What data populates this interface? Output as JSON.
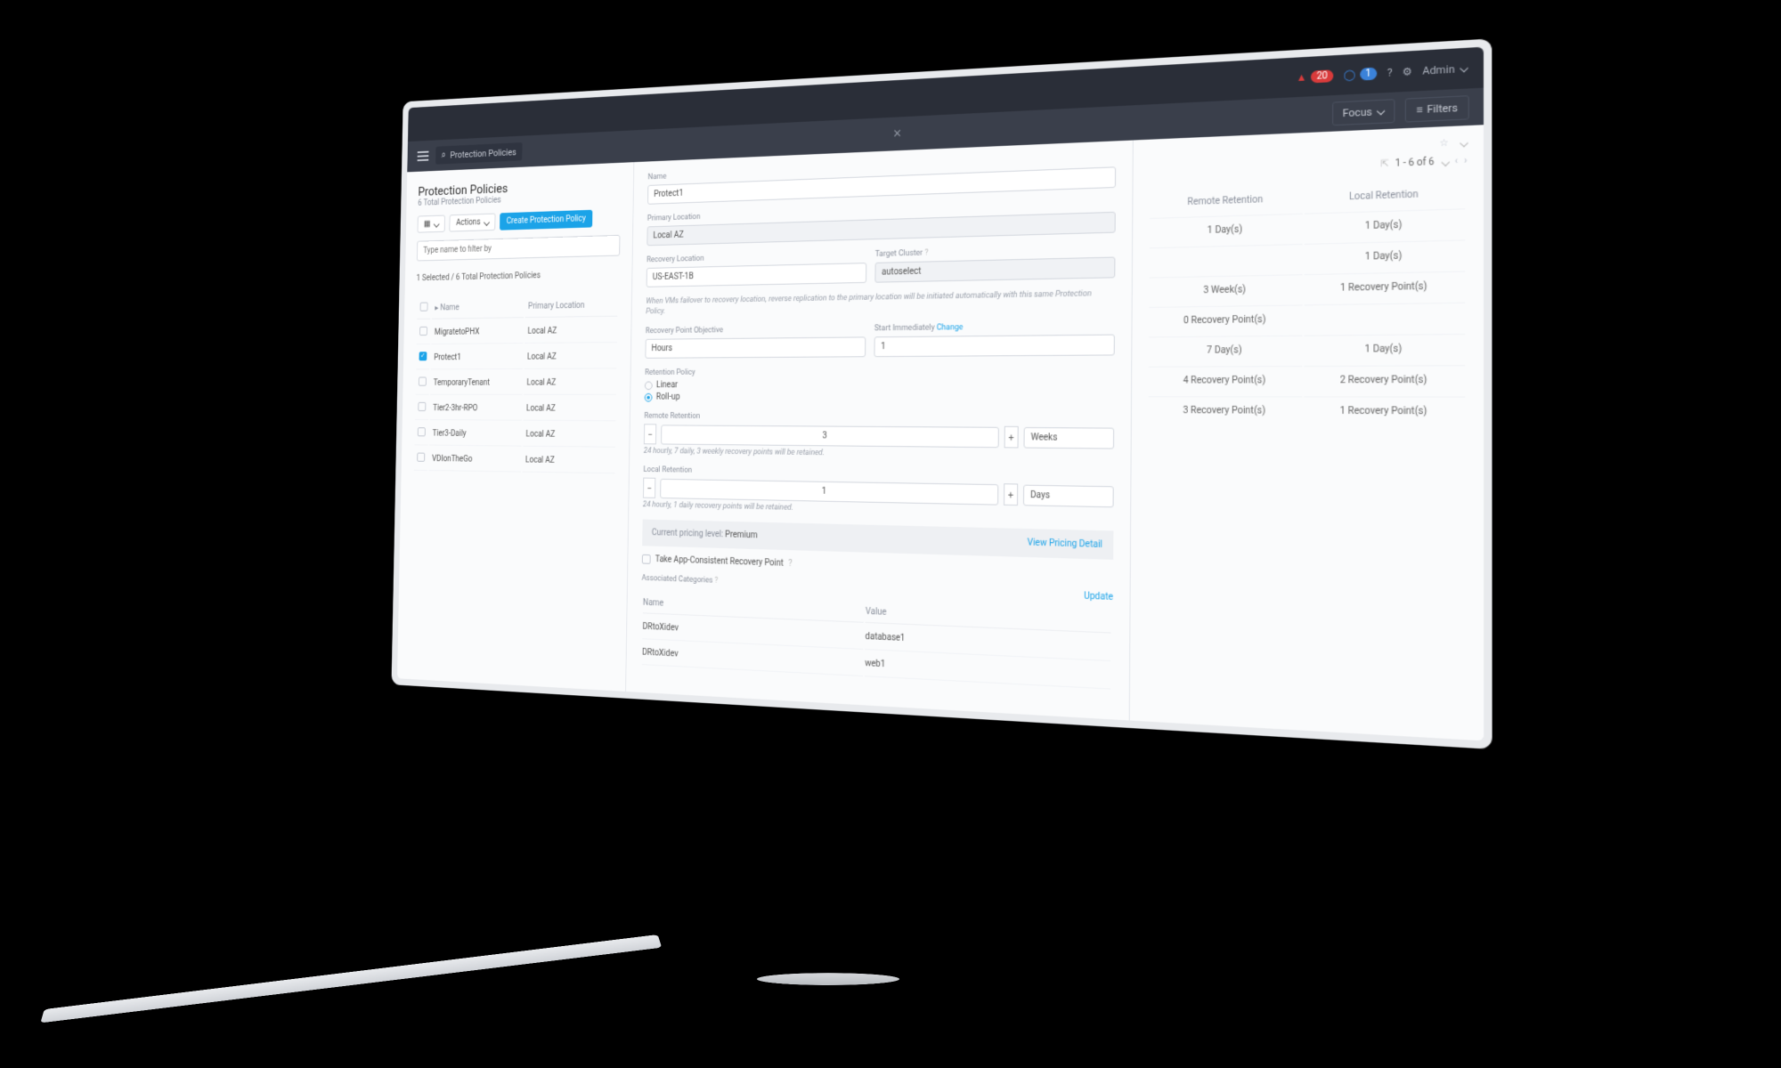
{
  "topbar": {
    "alert_count": "20",
    "task_count": "1",
    "user": "Admin"
  },
  "subbar": {
    "breadcrumb": "Protection Policies",
    "focus": "Focus",
    "filters": "Filters"
  },
  "page": {
    "title": "Protection Policies",
    "subtitle": "6 Total Protection Policies",
    "actions_label": "Actions",
    "create_label": "Create Protection Policy",
    "filter_placeholder": "Type name to filter by",
    "selected_summary": "1 Selected / 6 Total Protection Policies",
    "col_name": "Name",
    "col_primary": "Primary Location",
    "rows": [
      {
        "name": "MigratetoPHX",
        "loc": "Local AZ",
        "checked": false
      },
      {
        "name": "Protect1",
        "loc": "Local AZ",
        "checked": true
      },
      {
        "name": "TemporaryTenant",
        "loc": "Local AZ",
        "checked": false
      },
      {
        "name": "Tier2-3hr-RPO",
        "loc": "Local AZ",
        "checked": false
      },
      {
        "name": "Tier3-Daily",
        "loc": "Local AZ",
        "checked": false
      },
      {
        "name": "VDIonTheGo",
        "loc": "Local AZ",
        "checked": false
      }
    ]
  },
  "form": {
    "name_label": "Name",
    "name_value": "Protect1",
    "primary_loc_label": "Primary Location",
    "primary_loc_value": "Local AZ",
    "recovery_loc_label": "Recovery Location",
    "recovery_loc_value": "US-EAST-1B",
    "target_cluster_label": "Target Cluster",
    "target_cluster_value": "autoselect",
    "failover_note": "When VMs failover to recovery location, reverse replication to the primary location will be initiated automatically with this same Protection Policy.",
    "rpo_label": "Recovery Point Objective",
    "rpo_unit": "Hours",
    "rpo_value": "1",
    "start_immediately": "Start Immediately",
    "change": "Change",
    "retention_label": "Retention Policy",
    "retention_linear": "Linear",
    "retention_rollup": "Roll-up",
    "remote_ret_label": "Remote Retention",
    "remote_ret_value": "3",
    "remote_ret_unit": "Weeks",
    "remote_ret_note": "24 hourly, 7 daily, 3 weekly recovery points will be retained.",
    "local_ret_label": "Local Retention",
    "local_ret_value": "1",
    "local_ret_unit": "Days",
    "local_ret_note": "24 hourly, 1 daily recovery points will be retained.",
    "pricing_label": "Current pricing level:",
    "pricing_value": "Premium",
    "pricing_link": "View Pricing Detail",
    "app_consistent": "Take App-Consistent Recovery Point",
    "assoc_label": "Associated Categories",
    "update": "Update",
    "assoc_col_name": "Name",
    "assoc_col_value": "Value",
    "assoc_rows": [
      {
        "name": "DRtoXidev",
        "value": "database1"
      },
      {
        "name": "DRtoXidev",
        "value": "web1"
      }
    ]
  },
  "right": {
    "pager": "1 - 6 of 6",
    "col_remote": "Remote Retention",
    "col_local": "Local Retention",
    "rows": [
      {
        "remote": "1 Day(s)",
        "local": "1 Day(s)"
      },
      {
        "remote": "",
        "local": "1 Day(s)"
      },
      {
        "remote": "3 Week(s)",
        "local": "1 Recovery Point(s)"
      },
      {
        "remote": "0 Recovery Point(s)",
        "local": ""
      },
      {
        "remote": "7 Day(s)",
        "local": "1 Day(s)"
      },
      {
        "remote": "4 Recovery Point(s)",
        "local": "2 Recovery Point(s)"
      },
      {
        "remote": "3 Recovery Point(s)",
        "local": "1 Recovery Point(s)"
      }
    ]
  }
}
